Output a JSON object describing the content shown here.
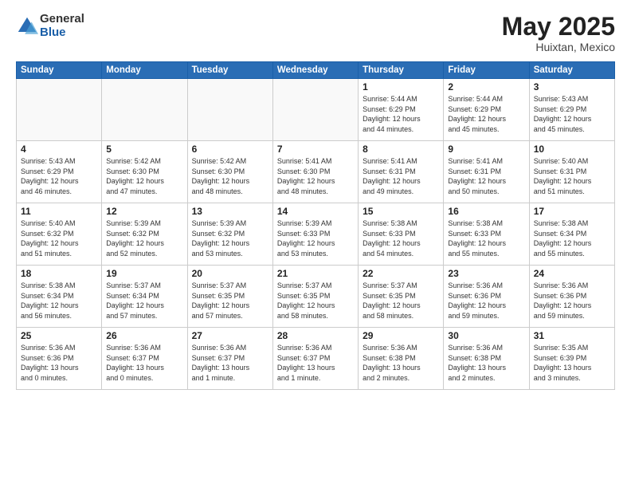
{
  "header": {
    "logo_general": "General",
    "logo_blue": "Blue",
    "month_title": "May 2025",
    "location": "Huixtan, Mexico"
  },
  "days_of_week": [
    "Sunday",
    "Monday",
    "Tuesday",
    "Wednesday",
    "Thursday",
    "Friday",
    "Saturday"
  ],
  "weeks": [
    [
      {
        "day": "",
        "info": ""
      },
      {
        "day": "",
        "info": ""
      },
      {
        "day": "",
        "info": ""
      },
      {
        "day": "",
        "info": ""
      },
      {
        "day": "1",
        "info": "Sunrise: 5:44 AM\nSunset: 6:29 PM\nDaylight: 12 hours\nand 44 minutes."
      },
      {
        "day": "2",
        "info": "Sunrise: 5:44 AM\nSunset: 6:29 PM\nDaylight: 12 hours\nand 45 minutes."
      },
      {
        "day": "3",
        "info": "Sunrise: 5:43 AM\nSunset: 6:29 PM\nDaylight: 12 hours\nand 45 minutes."
      }
    ],
    [
      {
        "day": "4",
        "info": "Sunrise: 5:43 AM\nSunset: 6:29 PM\nDaylight: 12 hours\nand 46 minutes."
      },
      {
        "day": "5",
        "info": "Sunrise: 5:42 AM\nSunset: 6:30 PM\nDaylight: 12 hours\nand 47 minutes."
      },
      {
        "day": "6",
        "info": "Sunrise: 5:42 AM\nSunset: 6:30 PM\nDaylight: 12 hours\nand 48 minutes."
      },
      {
        "day": "7",
        "info": "Sunrise: 5:41 AM\nSunset: 6:30 PM\nDaylight: 12 hours\nand 48 minutes."
      },
      {
        "day": "8",
        "info": "Sunrise: 5:41 AM\nSunset: 6:31 PM\nDaylight: 12 hours\nand 49 minutes."
      },
      {
        "day": "9",
        "info": "Sunrise: 5:41 AM\nSunset: 6:31 PM\nDaylight: 12 hours\nand 50 minutes."
      },
      {
        "day": "10",
        "info": "Sunrise: 5:40 AM\nSunset: 6:31 PM\nDaylight: 12 hours\nand 51 minutes."
      }
    ],
    [
      {
        "day": "11",
        "info": "Sunrise: 5:40 AM\nSunset: 6:32 PM\nDaylight: 12 hours\nand 51 minutes."
      },
      {
        "day": "12",
        "info": "Sunrise: 5:39 AM\nSunset: 6:32 PM\nDaylight: 12 hours\nand 52 minutes."
      },
      {
        "day": "13",
        "info": "Sunrise: 5:39 AM\nSunset: 6:32 PM\nDaylight: 12 hours\nand 53 minutes."
      },
      {
        "day": "14",
        "info": "Sunrise: 5:39 AM\nSunset: 6:33 PM\nDaylight: 12 hours\nand 53 minutes."
      },
      {
        "day": "15",
        "info": "Sunrise: 5:38 AM\nSunset: 6:33 PM\nDaylight: 12 hours\nand 54 minutes."
      },
      {
        "day": "16",
        "info": "Sunrise: 5:38 AM\nSunset: 6:33 PM\nDaylight: 12 hours\nand 55 minutes."
      },
      {
        "day": "17",
        "info": "Sunrise: 5:38 AM\nSunset: 6:34 PM\nDaylight: 12 hours\nand 55 minutes."
      }
    ],
    [
      {
        "day": "18",
        "info": "Sunrise: 5:38 AM\nSunset: 6:34 PM\nDaylight: 12 hours\nand 56 minutes."
      },
      {
        "day": "19",
        "info": "Sunrise: 5:37 AM\nSunset: 6:34 PM\nDaylight: 12 hours\nand 57 minutes."
      },
      {
        "day": "20",
        "info": "Sunrise: 5:37 AM\nSunset: 6:35 PM\nDaylight: 12 hours\nand 57 minutes."
      },
      {
        "day": "21",
        "info": "Sunrise: 5:37 AM\nSunset: 6:35 PM\nDaylight: 12 hours\nand 58 minutes."
      },
      {
        "day": "22",
        "info": "Sunrise: 5:37 AM\nSunset: 6:35 PM\nDaylight: 12 hours\nand 58 minutes."
      },
      {
        "day": "23",
        "info": "Sunrise: 5:36 AM\nSunset: 6:36 PM\nDaylight: 12 hours\nand 59 minutes."
      },
      {
        "day": "24",
        "info": "Sunrise: 5:36 AM\nSunset: 6:36 PM\nDaylight: 12 hours\nand 59 minutes."
      }
    ],
    [
      {
        "day": "25",
        "info": "Sunrise: 5:36 AM\nSunset: 6:36 PM\nDaylight: 13 hours\nand 0 minutes."
      },
      {
        "day": "26",
        "info": "Sunrise: 5:36 AM\nSunset: 6:37 PM\nDaylight: 13 hours\nand 0 minutes."
      },
      {
        "day": "27",
        "info": "Sunrise: 5:36 AM\nSunset: 6:37 PM\nDaylight: 13 hours\nand 1 minute."
      },
      {
        "day": "28",
        "info": "Sunrise: 5:36 AM\nSunset: 6:37 PM\nDaylight: 13 hours\nand 1 minute."
      },
      {
        "day": "29",
        "info": "Sunrise: 5:36 AM\nSunset: 6:38 PM\nDaylight: 13 hours\nand 2 minutes."
      },
      {
        "day": "30",
        "info": "Sunrise: 5:36 AM\nSunset: 6:38 PM\nDaylight: 13 hours\nand 2 minutes."
      },
      {
        "day": "31",
        "info": "Sunrise: 5:35 AM\nSunset: 6:39 PM\nDaylight: 13 hours\nand 3 minutes."
      }
    ]
  ]
}
